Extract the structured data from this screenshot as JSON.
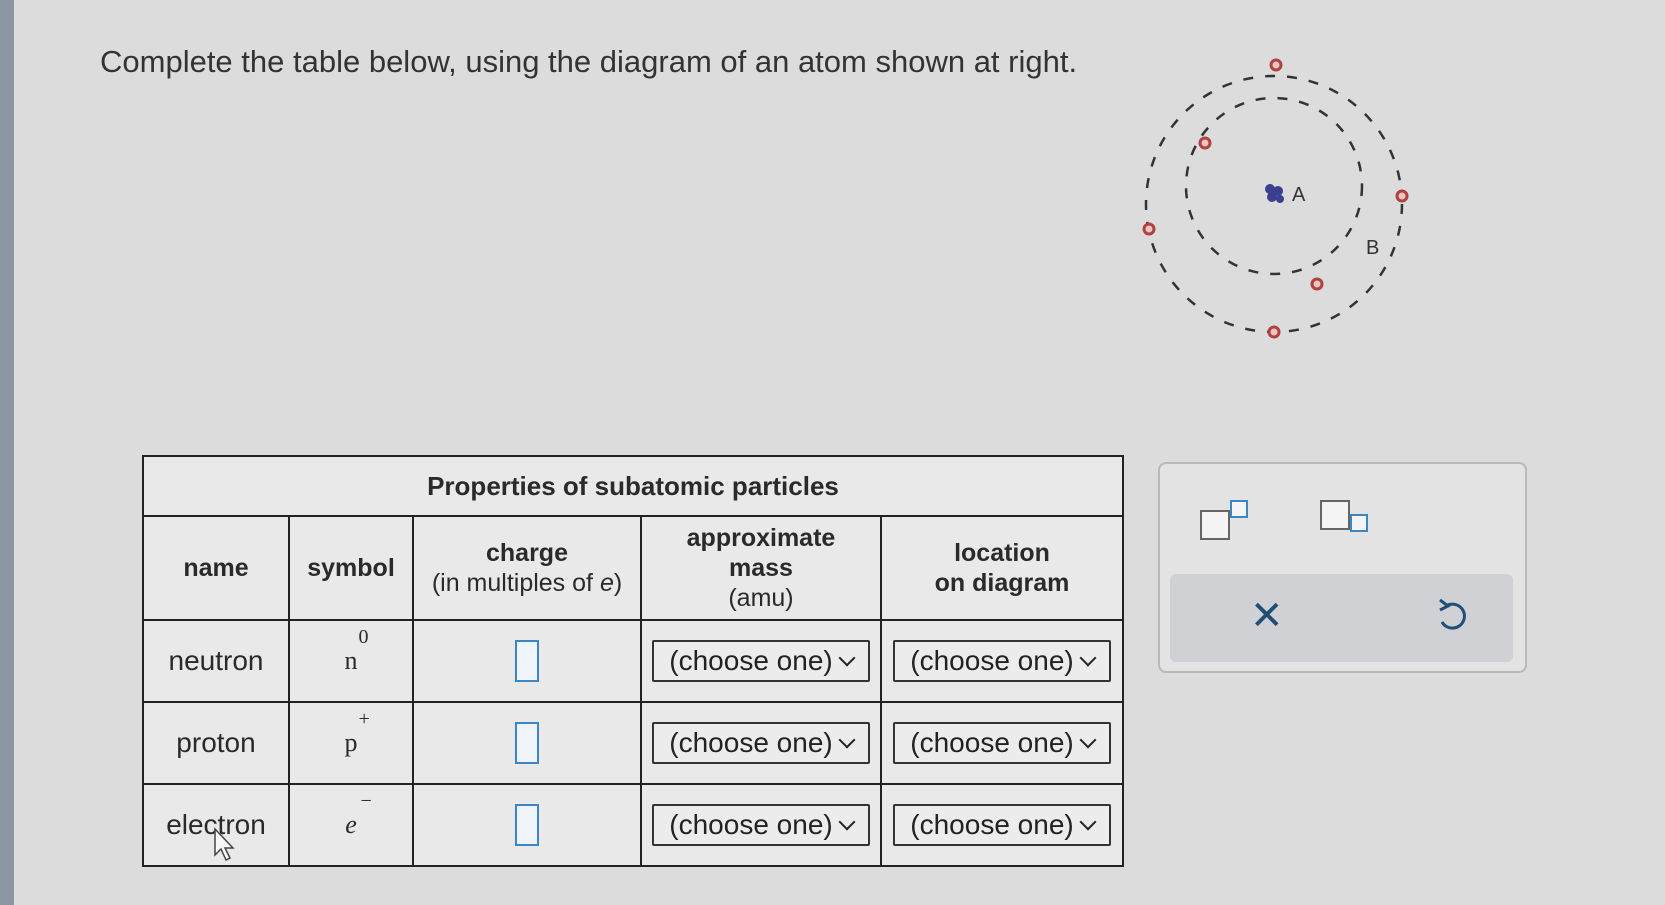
{
  "prompt": "Complete the table below, using the diagram of an atom shown at right.",
  "diagram": {
    "label_nucleus": "A",
    "label_shell": "B"
  },
  "table": {
    "title": "Properties of subatomic particles",
    "headers": {
      "name": "name",
      "symbol": "symbol",
      "charge_main": "charge",
      "charge_sub_prefix": "(in multiples of ",
      "charge_sub_var": "e",
      "charge_sub_suffix": ")",
      "mass_line1": "approximate",
      "mass_line2": "mass",
      "mass_line3": "(amu)",
      "location_line1": "location",
      "location_line2": "on diagram"
    },
    "rows": [
      {
        "name": "neutron",
        "symbol_base": "n",
        "symbol_sup": "0",
        "mass": "(choose one)",
        "location": "(choose one)"
      },
      {
        "name": "proton",
        "symbol_base": "p",
        "symbol_sup": "+",
        "mass": "(choose one)",
        "location": "(choose one)"
      },
      {
        "name": "electron",
        "symbol_base": "e",
        "symbol_sup": "−",
        "mass": "(choose one)",
        "location": "(choose one)"
      }
    ]
  },
  "colors": {
    "accent": "#3d86c6",
    "electron": "#b0413e",
    "nucleus": "#3a3f8f"
  }
}
